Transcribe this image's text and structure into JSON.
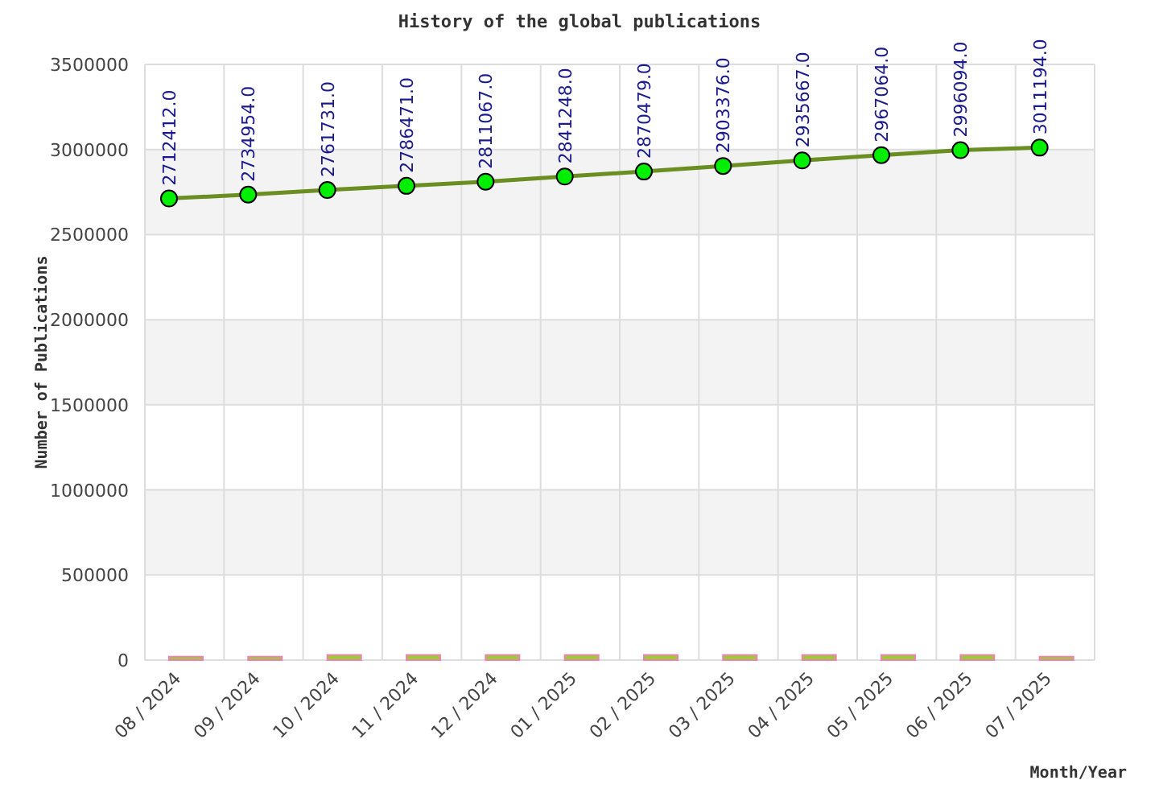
{
  "chart": {
    "chart_data": {
      "type": "line",
      "title": "History of the global publications",
      "xlabel": "Month/Year",
      "ylabel": "Number of Publications",
      "categories": [
        "08 / 2024",
        "09 / 2024",
        "10 / 2024",
        "11 / 2024",
        "12 / 2024",
        "01 / 2025",
        "02 / 2025",
        "03 / 2025",
        "04 / 2025",
        "05 / 2025",
        "06 / 2025",
        "07 / 2025"
      ],
      "series": [
        {
          "type": "line",
          "color": "#6b8e23",
          "marker": "circle",
          "values": [
            2712412,
            2734954,
            2761731,
            2786471,
            2811067,
            2841248,
            2870479,
            2903376,
            2935667,
            2967064,
            2996094,
            3011194
          ]
        },
        {
          "type": "bar",
          "color": "#9acd32",
          "values": [
            20000,
            20000,
            30000,
            30000,
            30000,
            30000,
            30000,
            30000,
            30000,
            30000,
            30000,
            20000
          ]
        }
      ],
      "grid": true,
      "ylim": [
        0,
        3500000
      ],
      "yticks": [
        0,
        500000,
        1000000,
        1500000,
        2000000,
        2500000,
        3000000,
        3500000
      ],
      "value_labels": [
        "2712412.0",
        "2734954.0",
        "2761731.0",
        "2786471.0",
        "2811067.0",
        "2841248.0",
        "2870479.0",
        "2903376.0",
        "2935667.0",
        "2967064.0",
        "2996094.0",
        "3011194.0"
      ]
    }
  }
}
